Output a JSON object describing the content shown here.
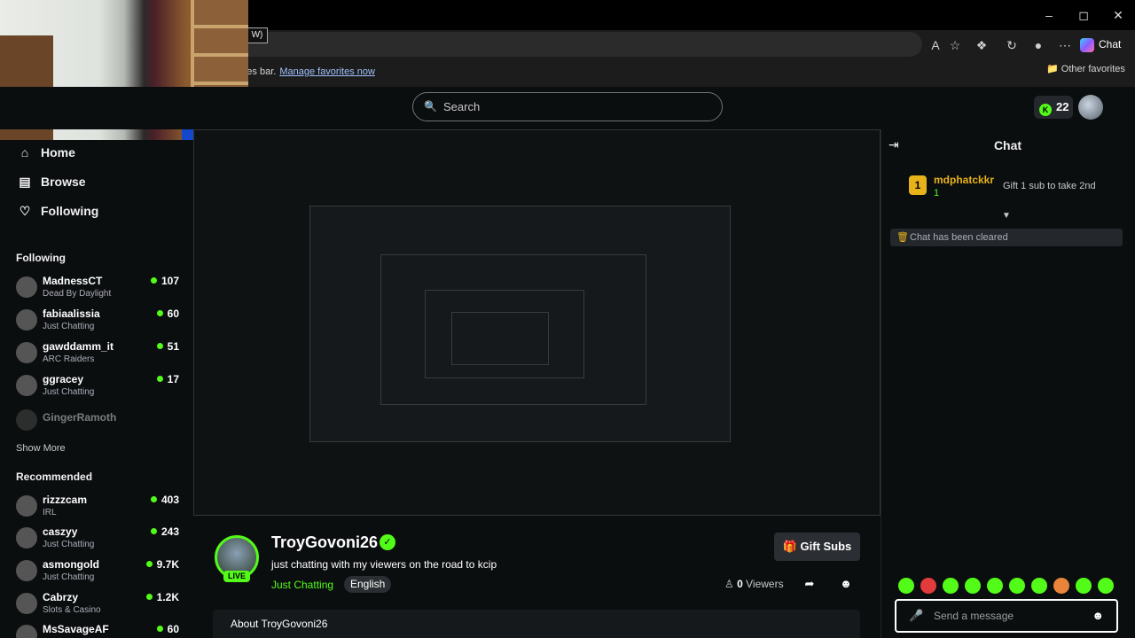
{
  "browser": {
    "favorites_text": "the favorites bar.",
    "manage_favorites": "Manage favorites now",
    "other_favorites": "Other favorites",
    "chat_button": "Chat",
    "kbd_hint": "W)"
  },
  "header": {
    "search_placeholder": "Search",
    "kicks_count": "22"
  },
  "sidebar": {
    "nav": [
      {
        "label": "Home",
        "icon": "home-icon"
      },
      {
        "label": "Browse",
        "icon": "browse-icon"
      },
      {
        "label": "Following",
        "icon": "heart-icon"
      }
    ],
    "following_title": "Following",
    "following": [
      {
        "name": "MadnessCT",
        "category": "Dead By Daylight",
        "viewers": "107"
      },
      {
        "name": "fabiaalissia",
        "category": "Just Chatting",
        "viewers": "60"
      },
      {
        "name": "gawddamm_it",
        "category": "ARC Raiders",
        "viewers": "51"
      },
      {
        "name": "ggracey",
        "category": "Just Chatting",
        "viewers": "17"
      }
    ],
    "offline_channel": "GingerRamoth",
    "show_more": "Show More",
    "recommended_title": "Recommended",
    "recommended": [
      {
        "name": "rizzzcam",
        "category": "IRL",
        "viewers": "403"
      },
      {
        "name": "caszyy",
        "category": "Just Chatting",
        "viewers": "243"
      },
      {
        "name": "asmongold",
        "category": "Just Chatting",
        "viewers": "9.7K"
      },
      {
        "name": "Cabrzy",
        "category": "Slots & Casino",
        "viewers": "1.2K"
      },
      {
        "name": "MsSavageAF",
        "category": "",
        "viewers": "60"
      }
    ]
  },
  "stream": {
    "streamer": "TroyGovoni26",
    "title": "just chatting with my viewers on the road to kcip",
    "category": "Just Chatting",
    "language": "English",
    "live_label": "LIVE",
    "gift_subs": "Gift Subs",
    "viewers_count": "0",
    "viewers_label": "Viewers",
    "about_label": "About TroyGovoni26"
  },
  "chat": {
    "title": "Chat",
    "pinned_user": "mdphatckkr",
    "pinned_rank": "1",
    "pinned_count": "1",
    "pinned_gift_text": "Gift 1 sub to take 2nd",
    "cleared_text": "Chat has been cleared",
    "input_placeholder": "Send a message",
    "emotes": [
      "emote",
      "emote",
      "emote",
      "emote",
      "emote",
      "emote",
      "emote",
      "emote",
      "emote",
      "emote"
    ]
  }
}
